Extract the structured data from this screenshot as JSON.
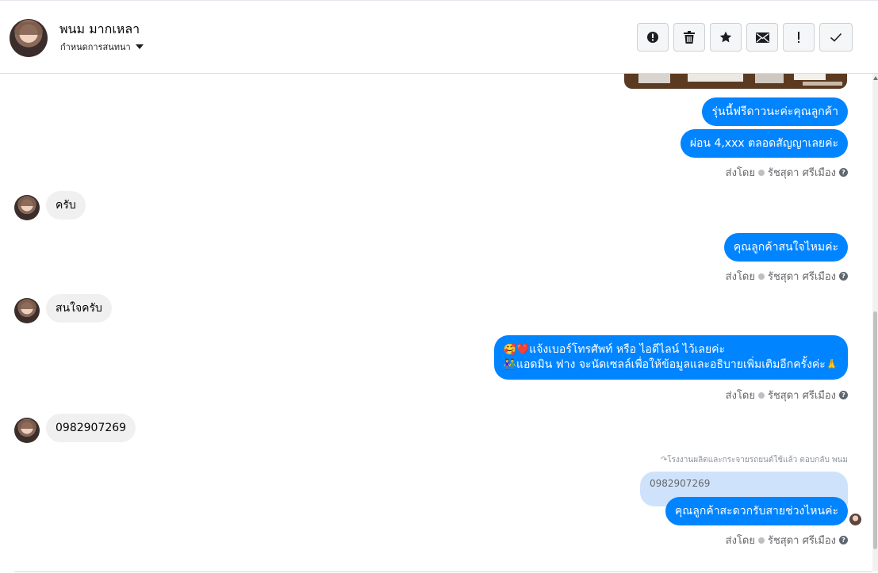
{
  "header": {
    "contact_name": "พนม มากเหลา",
    "assign_label": "กำหนดการสนทนา",
    "actions": [
      {
        "name": "report-icon",
        "label": "!"
      },
      {
        "name": "trash-icon",
        "label": ""
      },
      {
        "name": "star-icon",
        "label": ""
      },
      {
        "name": "mail-icon",
        "label": ""
      },
      {
        "name": "exclaim-icon",
        "label": "!"
      },
      {
        "name": "check-icon",
        "label": ""
      }
    ]
  },
  "messages": {
    "m1": "รุ่นนี้ฟรีดาวนะค่ะคุณลูกค้า",
    "m2": "ผ่อน 4,xxx ตลอดสัญญาเลยค่ะ",
    "m3": "ครับ",
    "m4": "คุณลูกค้าสนใจไหมค่ะ",
    "m5": "สนใจครับ",
    "m6_line1": "แจ้งเบอร์โทรศัพท์ หรือ ไอดีไลน์  ไว้เลยค่ะ",
    "m6_line1_emoji": "🥰❤️",
    "m6_line2": "แอดมิน ฟาง จะนัดเซลล์เพื่อให้ข้อมูลและอธิบายเพิ่มเติมอีกครั้งค่ะ",
    "m6_line2_emoji_start": "👫",
    "m6_line2_emoji_end": "🙏",
    "m7": "0982907269",
    "reply_note": "โรงงานผลิตและกระจายรถยนต์ใช้แล้ว ตอบกลับ พนม",
    "reply_quote": "0982907269",
    "m8": "คุณลูกค้าสะดวกรับสายช่วงไหนค่ะ"
  },
  "sent_by": {
    "prefix": "ส่งโดย",
    "agent": "รัชสุดา ศรีเมือง",
    "help": "?"
  },
  "colors": {
    "outgoing": "#0084ff",
    "incoming": "#f0f0f0",
    "reply_quote": "#cfe2fb"
  }
}
